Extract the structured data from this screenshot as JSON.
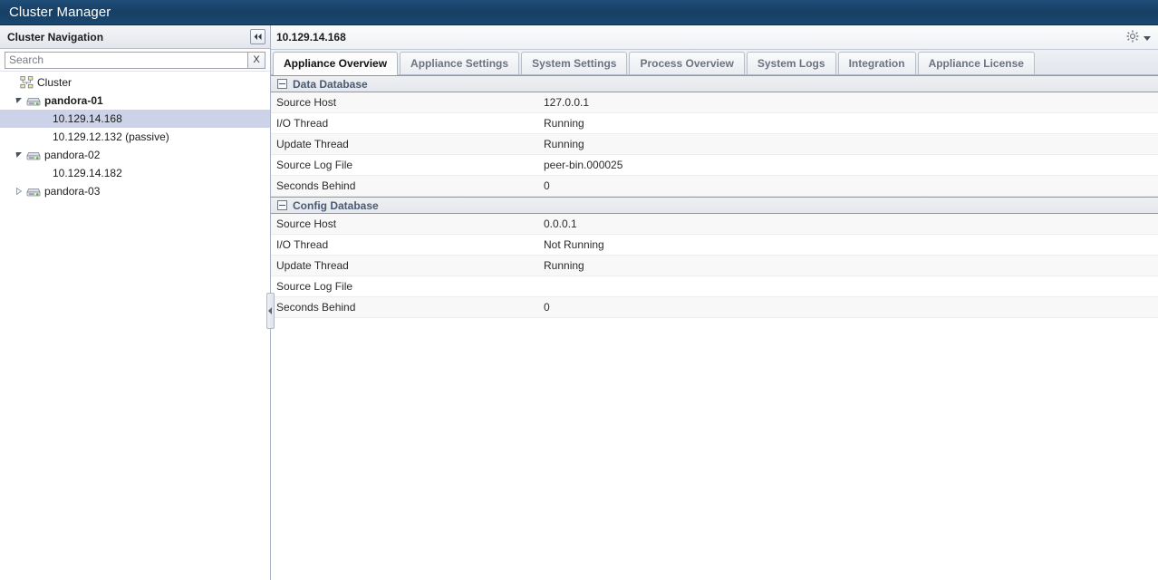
{
  "app": {
    "title": "Cluster Manager"
  },
  "nav": {
    "header_title": "Cluster Navigation",
    "collapse_icon": "chevron-double-left-icon",
    "search": {
      "placeholder": "Search",
      "value": "",
      "clear_label": "X"
    },
    "tree": [
      {
        "label": "Cluster",
        "depth": 0,
        "icon": "cluster-topology-icon",
        "state": "none",
        "bold": false,
        "selected": false
      },
      {
        "label": "pandora-01",
        "depth": 1,
        "icon": "appliance-icon",
        "state": "expanded",
        "bold": true,
        "selected": false
      },
      {
        "label": "10.129.14.168",
        "depth": 2,
        "icon": "none",
        "state": "none",
        "bold": false,
        "selected": true
      },
      {
        "label": "10.129.12.132 (passive)",
        "depth": 2,
        "icon": "none",
        "state": "none",
        "bold": false,
        "selected": false
      },
      {
        "label": "pandora-02",
        "depth": 1,
        "icon": "appliance-icon",
        "state": "expanded",
        "bold": false,
        "selected": false
      },
      {
        "label": "10.129.14.182",
        "depth": 2,
        "icon": "none",
        "state": "none",
        "bold": false,
        "selected": false
      },
      {
        "label": "pandora-03",
        "depth": 1,
        "icon": "appliance-icon",
        "state": "collapsed",
        "bold": false,
        "selected": false
      }
    ]
  },
  "content": {
    "title": "10.129.14.168",
    "settings_icon": "gear-icon",
    "settings_caret_icon": "caret-down-icon",
    "tabs": [
      {
        "label": "Appliance Overview",
        "active": true
      },
      {
        "label": "Appliance Settings",
        "active": false
      },
      {
        "label": "System Settings",
        "active": false
      },
      {
        "label": "Process Overview",
        "active": false
      },
      {
        "label": "System Logs",
        "active": false
      },
      {
        "label": "Integration",
        "active": false
      },
      {
        "label": "Appliance License",
        "active": false
      }
    ],
    "sections": [
      {
        "title": "Data Database",
        "collapsed": false,
        "rows": [
          {
            "key": "Source Host",
            "value": "127.0.0.1"
          },
          {
            "key": "I/O Thread",
            "value": "Running"
          },
          {
            "key": "Update Thread",
            "value": "Running"
          },
          {
            "key": "Source Log File",
            "value": "peer-bin.000025"
          },
          {
            "key": "Seconds Behind",
            "value": "0"
          }
        ]
      },
      {
        "title": "Config Database",
        "collapsed": false,
        "rows": [
          {
            "key": "Source Host",
            "value": "0.0.0.1"
          },
          {
            "key": "I/O Thread",
            "value": "Not Running"
          },
          {
            "key": "Update Thread",
            "value": "Running"
          },
          {
            "key": "Source Log File",
            "value": ""
          },
          {
            "key": "Seconds Behind",
            "value": "0"
          }
        ]
      }
    ]
  },
  "colors": {
    "titlebar": "#1f4e79",
    "selection": "#ccd3e8",
    "section_title": "#4a5a75",
    "tab_active_text": "#111111",
    "tab_inactive_text": "#6b7380"
  }
}
